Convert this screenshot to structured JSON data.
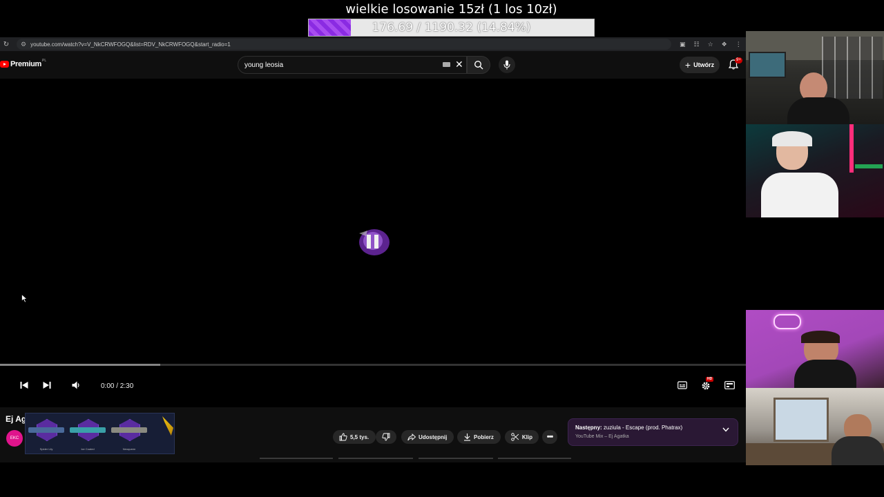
{
  "overlay": {
    "goal_title": "wielkie losowanie 15zł (1 los 10zł)",
    "goal_progress_text": "176.69 / 1190.32 (14.84%)",
    "goal_fraction": 0.1484,
    "fill_color": "#8a2be2"
  },
  "browser": {
    "url": "youtube.com/watch?v=V_NkCRWFOGQ&list=RDV_NkCRWFOGQ&start_radio=1",
    "icons": [
      "reload-icon",
      "install-icon",
      "translate-icon",
      "star-icon",
      "extensions-icon",
      "menu-icon"
    ]
  },
  "header": {
    "logo_text": "Premium",
    "region": "PL",
    "search_value": "young leosia",
    "create_label": "Utwórz",
    "notification_badge": "9+"
  },
  "player": {
    "time": "0:00 / 2:30",
    "hd_badge": "HD",
    "loaded_fraction": 0.215,
    "played_fraction": 0.0
  },
  "video": {
    "title": "Ej Ag",
    "channel_avatar_text": "EKC",
    "skins": [
      {
        "name": "Spider Lily",
        "gun_color": "#4a6a9a"
      },
      {
        "name": "Ice Coaled",
        "gun_color": "#3aa0a8"
      },
      {
        "name": "Neoqueen",
        "gun_color": "#8a8a80"
      }
    ],
    "actions": {
      "likes": "5,5 tys.",
      "share": "Udostępnij",
      "download": "Pobierz",
      "clip": "Klip"
    },
    "next": {
      "label": "Następny:",
      "title": "zuziula - Escape (prod. Phatrax)",
      "subtitle": "YouTube Mix – Ej Agatka"
    }
  },
  "colors": {
    "yt_red": "#ff0000",
    "badge_red": "#cc0000",
    "bg": "#0f0f0f"
  }
}
